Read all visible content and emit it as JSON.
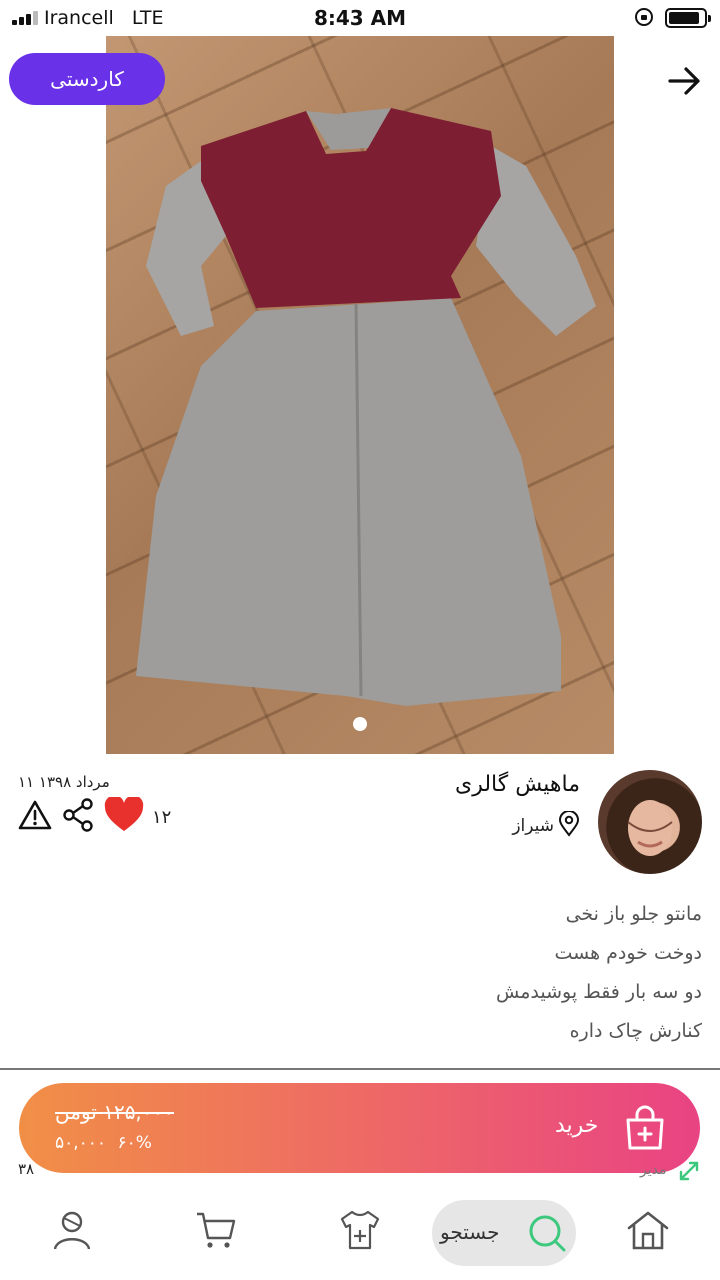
{
  "status_bar": {
    "carrier": "Irancell",
    "network": "LTE",
    "time": "8:43 AM"
  },
  "post": {
    "tag": "کاردستی",
    "seller_name": "ماهیش گالری",
    "city": "شیراز",
    "date": "مرداد ۱۳۹۸ ۱۱",
    "likes": "۱۲",
    "description": [
      "مانتو جلو باز نخی",
      "دوخت خودم هست",
      "دو سه بار فقط پوشیدمش",
      "کنارش چاک داره"
    ]
  },
  "buy_bar": {
    "buy_label": "خرید",
    "old_price": "۱۲۵,۰۰۰ تومن",
    "new_price": "۵۰,۰۰۰",
    "discount": "۶۰%",
    "under_left": "۳۸",
    "under_right": "مدیر"
  },
  "nav": {
    "search_label": "جستجو"
  },
  "colors": {
    "tag_bg": "#6a32e8",
    "buy_gradient_start": "#f18f46",
    "buy_gradient_end": "#e94383",
    "like_heart": "#e8312c",
    "search_accent": "#3cc97e"
  }
}
